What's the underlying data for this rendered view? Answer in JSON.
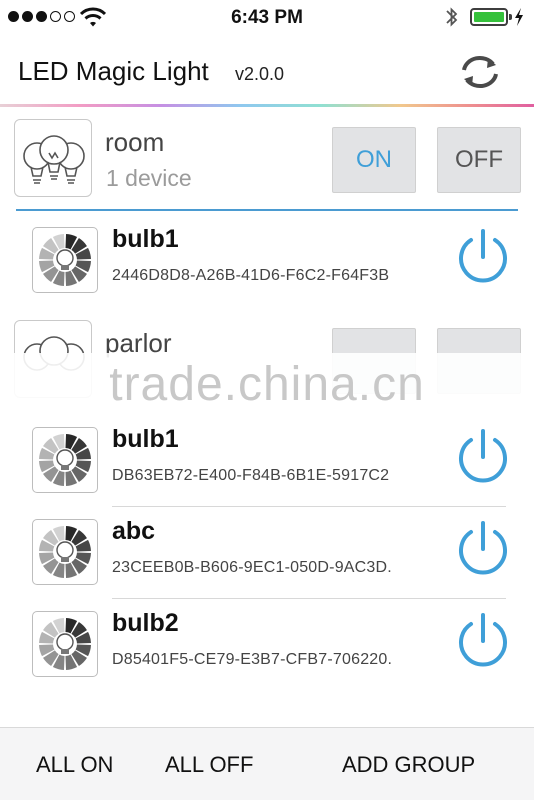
{
  "status_bar": {
    "time": "6:43 PM",
    "signal_bars_filled": 3,
    "signal_bars_total": 5,
    "battery_level": 1.0
  },
  "header": {
    "title": "LED Magic Light",
    "version": "v2.0.0"
  },
  "groups": [
    {
      "name": "room",
      "count": "1 device",
      "on_label": "ON",
      "off_label": "OFF"
    },
    {
      "name": "parlor"
    }
  ],
  "devices": [
    {
      "name": "bulb1",
      "id": "2446D8D8-A26B-41D6-F6C2-F64F3B"
    },
    {
      "name": "bulb1",
      "id": "DB63EB72-E400-F84B-6B1E-5917C2"
    },
    {
      "name": "abc",
      "id": "23CEEB0B-B606-9EC1-050D-9AC3D."
    },
    {
      "name": "bulb2",
      "id": "D85401F5-CE79-E3B7-CFB7-706220."
    }
  ],
  "watermark": "trade.china.cn",
  "bottom_bar": {
    "all_on": "ALL ON",
    "all_off": "ALL OFF",
    "add_group": "ADD GROUP"
  },
  "colors": {
    "accent_blue": "#3f9fd8",
    "battery_green": "#35c13b",
    "button_gray": "#e2e3e5"
  },
  "icons": [
    "wifi-icon",
    "bluetooth-icon",
    "battery-icon",
    "refresh-icon",
    "bulb-group-icon",
    "bulb-wheel-icon",
    "power-icon"
  ]
}
